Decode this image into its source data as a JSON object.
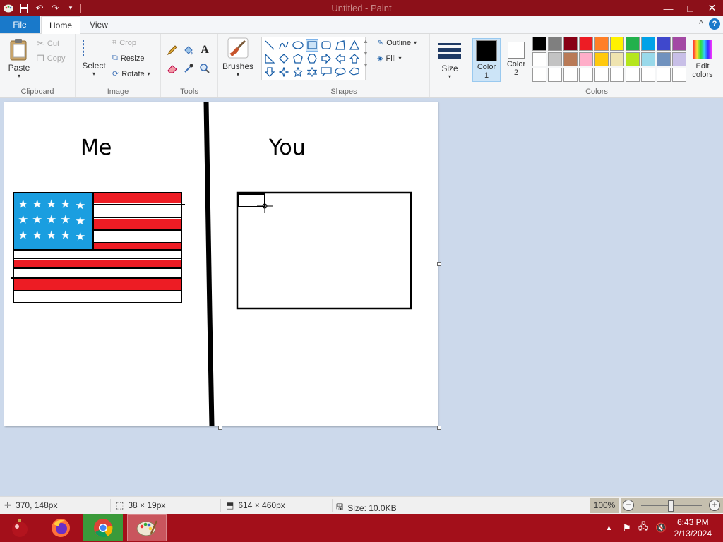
{
  "window": {
    "title": "Untitled - Paint",
    "minimize": "—",
    "maximize": "□",
    "close": "✕"
  },
  "ribbon_tabs": [
    "File",
    "Home",
    "View"
  ],
  "clipboard": {
    "paste": "Paste",
    "cut": "Cut",
    "copy": "Copy",
    "group": "Clipboard"
  },
  "image": {
    "select": "Select",
    "crop": "Crop",
    "resize": "Resize",
    "rotate": "Rotate",
    "group": "Image"
  },
  "tools": {
    "group": "Tools"
  },
  "brushes": {
    "label": "Brushes"
  },
  "shapes": {
    "outline": "Outline",
    "fill": "Fill",
    "group": "Shapes"
  },
  "size": {
    "label": "Size"
  },
  "colors": {
    "color1_label": "Color 1",
    "color2_label": "Color 2",
    "color1": "#000000",
    "color2": "#ffffff",
    "edit": "Edit colors",
    "group": "Colors",
    "palette": [
      "#000000",
      "#7f7f7f",
      "#880015",
      "#ed1c24",
      "#ff7f27",
      "#fff200",
      "#22b14c",
      "#00a2e8",
      "#3f48cc",
      "#a349a4",
      "#ffffff",
      "#c3c3c3",
      "#b97a57",
      "#ffaec9",
      "#ffc90e",
      "#efe4b0",
      "#b5e61d",
      "#99d9ea",
      "#7092be",
      "#c8bfe7",
      "#ffffff",
      "#ffffff",
      "#ffffff",
      "#ffffff",
      "#ffffff",
      "#ffffff",
      "#ffffff",
      "#ffffff",
      "#ffffff",
      "#ffffff"
    ]
  },
  "drawing": {
    "left_label": "Me",
    "right_label": "You",
    "flag_blue": "#1a9ee0",
    "flag_red": "#ed1c24"
  },
  "statusbar": {
    "cursor_pos": "370, 148px",
    "selection_size": "38 × 19px",
    "canvas_size": "614 × 460px",
    "file_size": "Size: 10.0KB",
    "zoom": "100%"
  },
  "taskbar": {
    "time": "6:43 PM",
    "date": "2/13/2024"
  }
}
